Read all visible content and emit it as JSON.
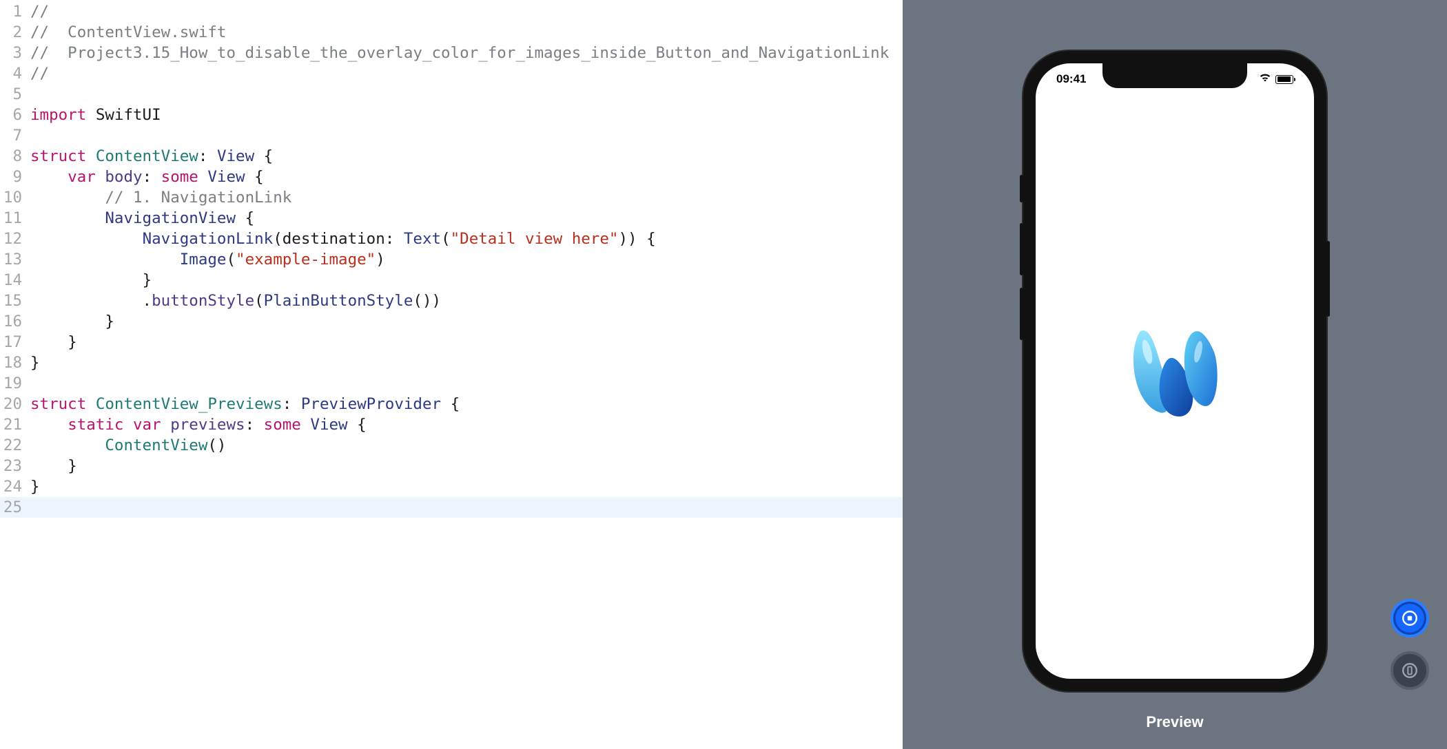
{
  "editor": {
    "lines": [
      {
        "n": 1,
        "tokens": [
          {
            "cls": "tok-comment",
            "t": "//"
          }
        ]
      },
      {
        "n": 2,
        "tokens": [
          {
            "cls": "tok-comment",
            "t": "//  ContentView.swift"
          }
        ]
      },
      {
        "n": 3,
        "tokens": [
          {
            "cls": "tok-comment",
            "t": "//  Project3.15_How_to_disable_the_overlay_color_for_images_inside_Button_and_NavigationLink"
          }
        ]
      },
      {
        "n": 4,
        "tokens": [
          {
            "cls": "tok-comment",
            "t": "//"
          }
        ]
      },
      {
        "n": 5,
        "tokens": []
      },
      {
        "n": 6,
        "tokens": [
          {
            "cls": "tok-keyword",
            "t": "import"
          },
          {
            "t": " "
          },
          {
            "cls": "tok-punct",
            "t": "SwiftUI"
          }
        ]
      },
      {
        "n": 7,
        "tokens": []
      },
      {
        "n": 8,
        "tokens": [
          {
            "cls": "tok-keyword",
            "t": "struct"
          },
          {
            "t": " "
          },
          {
            "cls": "tok-typedef",
            "t": "ContentView"
          },
          {
            "cls": "tok-punct",
            "t": ": "
          },
          {
            "cls": "tok-type",
            "t": "View"
          },
          {
            "cls": "tok-punct",
            "t": " {"
          }
        ]
      },
      {
        "n": 9,
        "tokens": [
          {
            "t": "    "
          },
          {
            "cls": "tok-keyword",
            "t": "var"
          },
          {
            "t": " "
          },
          {
            "cls": "tok-method",
            "t": "body"
          },
          {
            "cls": "tok-punct",
            "t": ": "
          },
          {
            "cls": "tok-keyword",
            "t": "some"
          },
          {
            "t": " "
          },
          {
            "cls": "tok-type",
            "t": "View"
          },
          {
            "cls": "tok-punct",
            "t": " {"
          }
        ]
      },
      {
        "n": 10,
        "tokens": [
          {
            "t": "        "
          },
          {
            "cls": "tok-comment",
            "t": "// 1. NavigationLink"
          }
        ]
      },
      {
        "n": 11,
        "tokens": [
          {
            "t": "        "
          },
          {
            "cls": "tok-type",
            "t": "NavigationView"
          },
          {
            "cls": "tok-punct",
            "t": " {"
          }
        ]
      },
      {
        "n": 12,
        "tokens": [
          {
            "t": "            "
          },
          {
            "cls": "tok-type",
            "t": "NavigationLink"
          },
          {
            "cls": "tok-punct",
            "t": "(destination: "
          },
          {
            "cls": "tok-type",
            "t": "Text"
          },
          {
            "cls": "tok-punct",
            "t": "("
          },
          {
            "cls": "tok-string",
            "t": "\"Detail view here\""
          },
          {
            "cls": "tok-punct",
            "t": ")) {"
          }
        ]
      },
      {
        "n": 13,
        "tokens": [
          {
            "t": "                "
          },
          {
            "cls": "tok-type",
            "t": "Image"
          },
          {
            "cls": "tok-punct",
            "t": "("
          },
          {
            "cls": "tok-string",
            "t": "\"example-image\""
          },
          {
            "cls": "tok-punct",
            "t": ")"
          }
        ]
      },
      {
        "n": 14,
        "tokens": [
          {
            "t": "            "
          },
          {
            "cls": "tok-punct",
            "t": "}"
          }
        ]
      },
      {
        "n": 15,
        "tokens": [
          {
            "t": "            ."
          },
          {
            "cls": "tok-method",
            "t": "buttonStyle"
          },
          {
            "cls": "tok-punct",
            "t": "("
          },
          {
            "cls": "tok-type",
            "t": "PlainButtonStyle"
          },
          {
            "cls": "tok-punct",
            "t": "())"
          }
        ]
      },
      {
        "n": 16,
        "tokens": [
          {
            "t": "        "
          },
          {
            "cls": "tok-punct",
            "t": "}"
          }
        ]
      },
      {
        "n": 17,
        "tokens": [
          {
            "t": "    "
          },
          {
            "cls": "tok-punct",
            "t": "}"
          }
        ]
      },
      {
        "n": 18,
        "tokens": [
          {
            "cls": "tok-punct",
            "t": "}"
          }
        ]
      },
      {
        "n": 19,
        "tokens": []
      },
      {
        "n": 20,
        "tokens": [
          {
            "cls": "tok-keyword",
            "t": "struct"
          },
          {
            "t": " "
          },
          {
            "cls": "tok-typedef",
            "t": "ContentView_Previews"
          },
          {
            "cls": "tok-punct",
            "t": ": "
          },
          {
            "cls": "tok-type",
            "t": "PreviewProvider"
          },
          {
            "cls": "tok-punct",
            "t": " {"
          }
        ]
      },
      {
        "n": 21,
        "tokens": [
          {
            "t": "    "
          },
          {
            "cls": "tok-keyword",
            "t": "static"
          },
          {
            "t": " "
          },
          {
            "cls": "tok-keyword",
            "t": "var"
          },
          {
            "t": " "
          },
          {
            "cls": "tok-method",
            "t": "previews"
          },
          {
            "cls": "tok-punct",
            "t": ": "
          },
          {
            "cls": "tok-keyword",
            "t": "some"
          },
          {
            "t": " "
          },
          {
            "cls": "tok-type",
            "t": "View"
          },
          {
            "cls": "tok-punct",
            "t": " {"
          }
        ]
      },
      {
        "n": 22,
        "tokens": [
          {
            "t": "        "
          },
          {
            "cls": "tok-typedef",
            "t": "ContentView"
          },
          {
            "cls": "tok-punct",
            "t": "()"
          }
        ]
      },
      {
        "n": 23,
        "tokens": [
          {
            "t": "    "
          },
          {
            "cls": "tok-punct",
            "t": "}"
          }
        ]
      },
      {
        "n": 24,
        "tokens": [
          {
            "cls": "tok-punct",
            "t": "}"
          }
        ]
      },
      {
        "n": 25,
        "tokens": [],
        "cursor": true
      }
    ]
  },
  "preview": {
    "label": "Preview",
    "status_time": "09:41"
  }
}
